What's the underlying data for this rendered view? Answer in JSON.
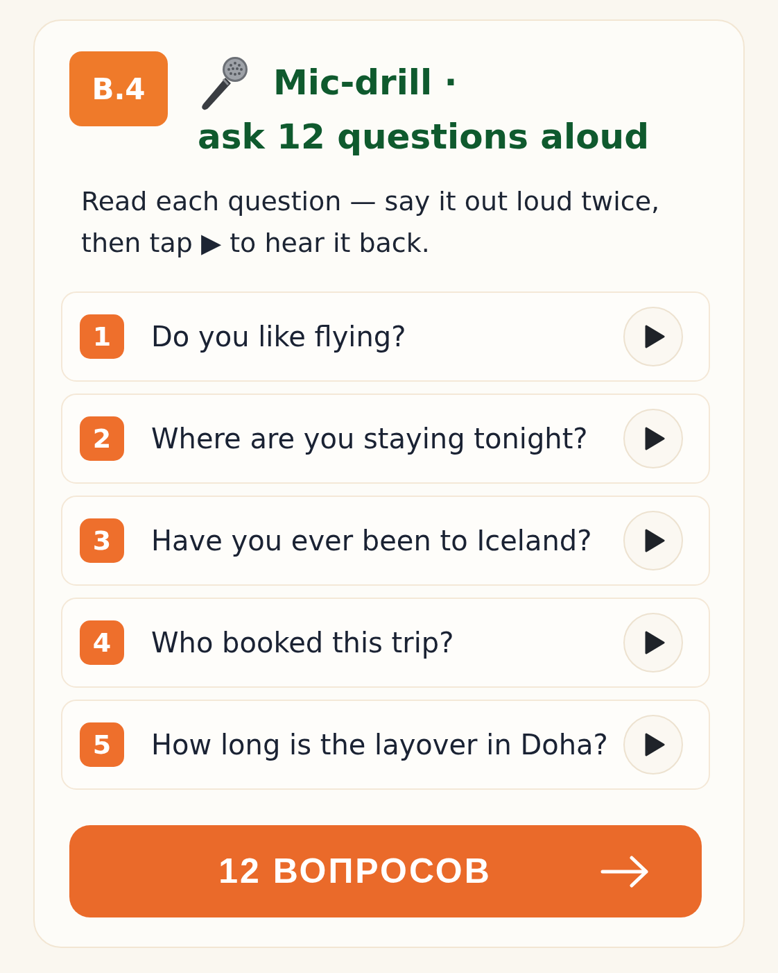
{
  "card": {
    "section_label": "B.4",
    "title_lines": [
      "Mic-drill ·",
      "ask 12 questions aloud"
    ],
    "instructions": "Read each question — say it out loud twice, then tap ▶ to hear it back."
  },
  "questions": [
    {
      "number": "1",
      "text": "Do you like flying?"
    },
    {
      "number": "2",
      "text": "Where are you staying tonight?"
    },
    {
      "number": "3",
      "text": "Have you ever been to Iceland?"
    },
    {
      "number": "4",
      "text": "Who booked this trip?"
    },
    {
      "number": "5",
      "text": "How long is the layover in Doha?"
    }
  ],
  "next_button": {
    "label": "12 ВОПРОСОВ"
  }
}
